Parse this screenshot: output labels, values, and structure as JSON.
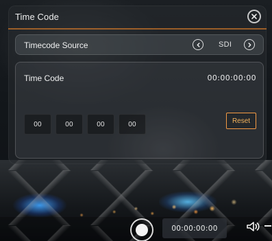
{
  "dialog": {
    "title": "Time Code"
  },
  "timecode_source": {
    "label": "Timecode Source",
    "value": "SDI"
  },
  "timecode": {
    "label": "Time Code",
    "value": "00:00:00:00",
    "fields": [
      "00",
      "00",
      "00",
      "00"
    ],
    "reset_label": "Reset"
  },
  "bottom_bar": {
    "timecode": "00:00:00:00"
  },
  "icons": {
    "close": "close-icon",
    "prev": "chevron-left-icon",
    "next": "chevron-right-icon",
    "record": "record-icon",
    "speaker": "speaker-icon"
  },
  "colors": {
    "accent_orange": "#FF9F46",
    "panel_bg": "#2C3034",
    "text": "#FFFFFF"
  }
}
